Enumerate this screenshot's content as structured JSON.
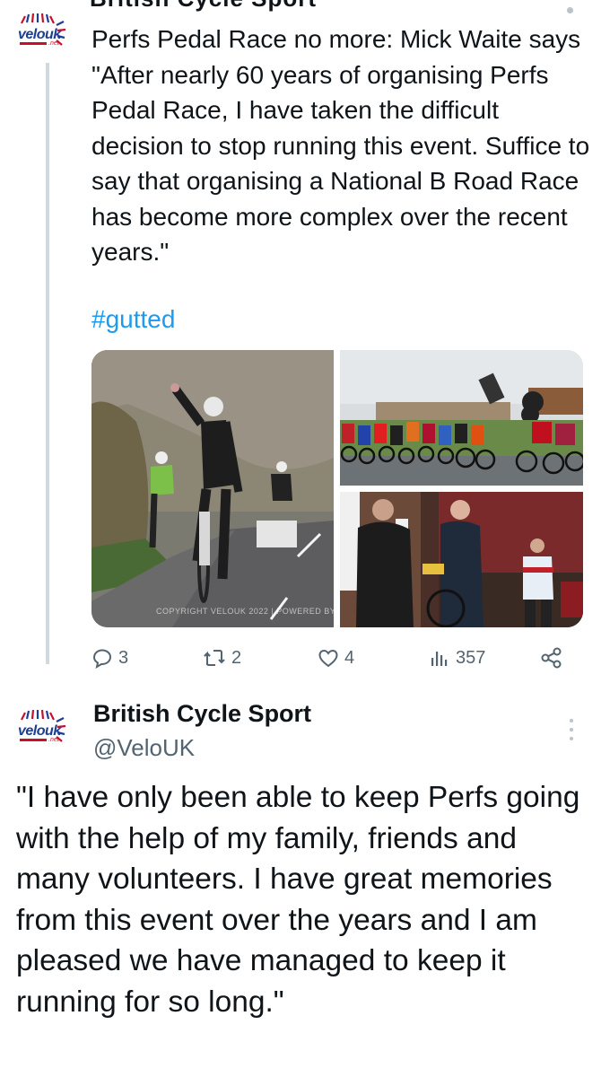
{
  "top_partial": {
    "text": "British Cycle Sport"
  },
  "tweet1": {
    "avatar_label": "velouk",
    "avatar_sub": ".net",
    "text": "Perfs Pedal Race no more: Mick Waite says \"After nearly 60 years of organising Perfs Pedal Race, I have taken the difficult decision to stop running this event. Suffice to say that organising a National B Road Race has become more complex over the recent years.\"",
    "hashtag": "#gutted",
    "photo_copyright": "COPYRIGHT VELOUK 2022 | POWERED BY",
    "stats": {
      "replies": "3",
      "retweets": "2",
      "likes": "4",
      "views": "357"
    }
  },
  "tweet2": {
    "avatar_label": "velouk",
    "avatar_sub": ".net",
    "author_name": "British Cycle Sport",
    "author_handle": "@VeloUK",
    "text": "\"I have only been able to keep Perfs going with the help of my family, friends and many volunteers. I have great memories from this event over the years and I am pleased we have managed to keep it running for so long.\""
  },
  "icons": {
    "reply": "speech-bubble-icon",
    "retweet": "retweet-arrows-icon",
    "like": "heart-icon",
    "views": "bar-chart-icon",
    "share": "share-nodes-icon",
    "more": "vertical-dots-icon"
  },
  "colors": {
    "text": "#0f1419",
    "muted": "#536471",
    "link": "#1d9bf0",
    "logo_blue": "#1d3f8f",
    "logo_red": "#c8102e"
  }
}
